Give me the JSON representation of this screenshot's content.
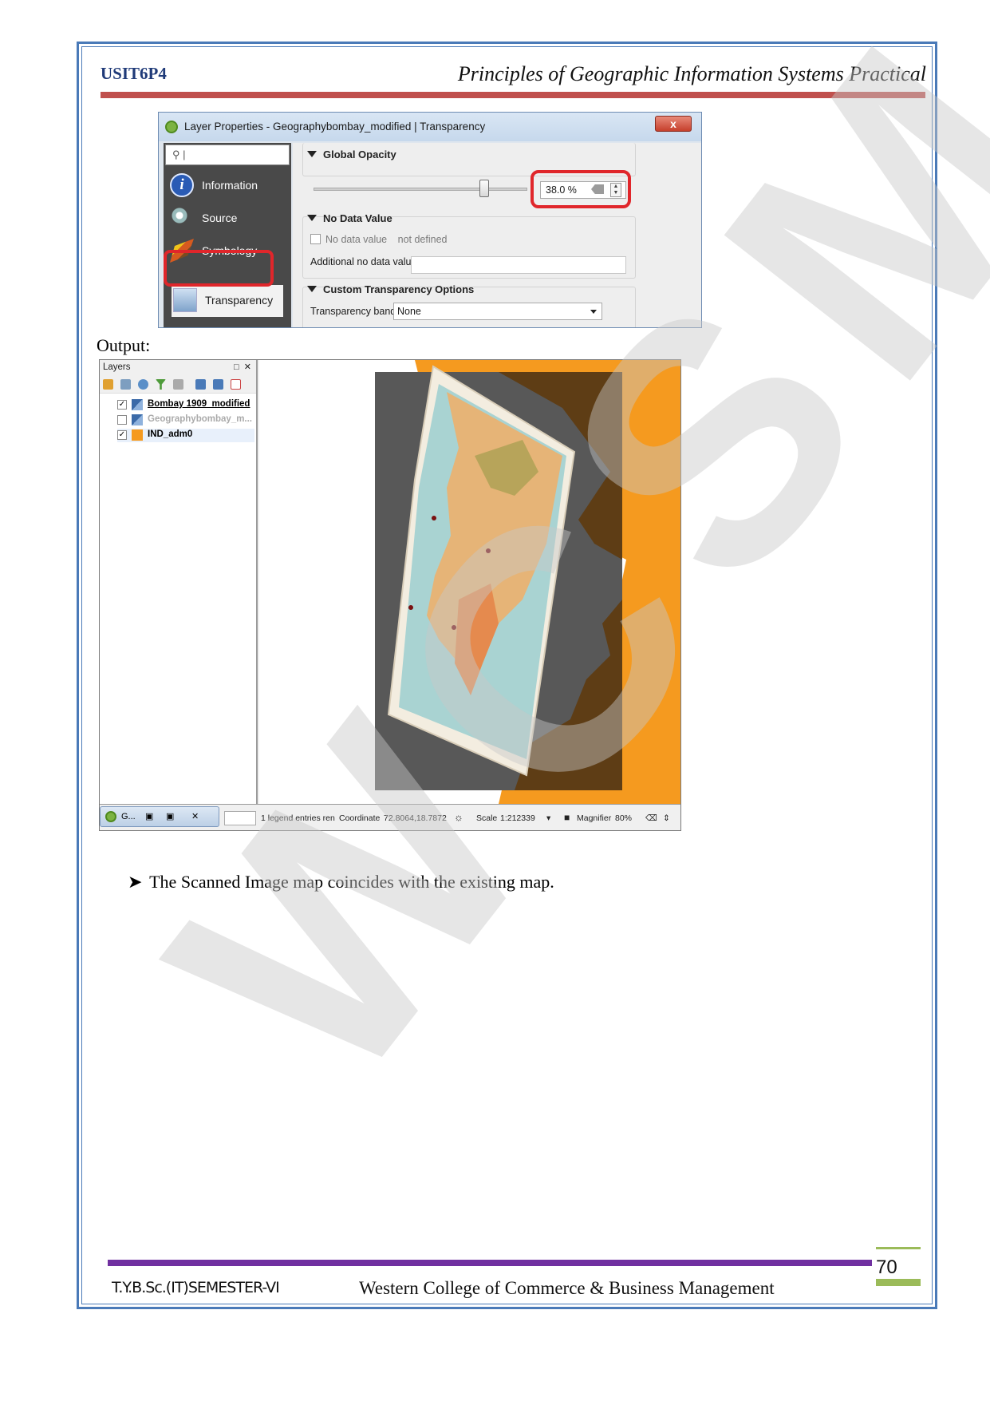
{
  "header": {
    "course_code": "USIT6P4",
    "title": "Principles of Geographic Information Systems Practical"
  },
  "dialog": {
    "title": "Layer Properties - Geographybombay_modified | Transparency",
    "close_label": "x",
    "search_value": "|",
    "sidebar_items": [
      {
        "label": "Information",
        "icon": "information-icon"
      },
      {
        "label": "Source",
        "icon": "source-icon"
      },
      {
        "label": "Symbology",
        "icon": "symbology-icon"
      },
      {
        "label": "Transparency",
        "icon": "transparency-icon",
        "selected": true
      }
    ],
    "global_opacity": {
      "header": "Global Opacity",
      "value_text": "38.0 %",
      "value": 38.0
    },
    "no_data": {
      "header": "No Data Value",
      "checkbox_label": "No data value",
      "checkbox_value": "not defined",
      "additional_label": "Additional no data value",
      "additional_value": ""
    },
    "custom_transparency": {
      "header": "Custom Transparency Options",
      "band_label": "Transparency band",
      "band_value": "None"
    }
  },
  "output_label": "Output:",
  "qgis": {
    "layers_title": "Layers",
    "layers": [
      {
        "name": "Bombay 1909_modified",
        "checked": true,
        "swatch": "raster-icon"
      },
      {
        "name": "Geographybombay_m...",
        "checked": false,
        "swatch": "raster-icon"
      },
      {
        "name": "IND_adm0",
        "checked": true,
        "swatch": "#f59a1f"
      }
    ],
    "status": {
      "task_label": "G...",
      "legend_text": "1 legend entries ren",
      "coordinate_label": "Coordinate",
      "coordinate_value": "72.8064,18.7872",
      "scale_label": "Scale",
      "scale_value": "1:212339",
      "magnifier_label": "Magnifier",
      "magnifier_value": "80%"
    }
  },
  "bullet_text": "The Scanned Image map coincides with the existing map.",
  "footer": {
    "left": "T.Y.B.Sc.(IT)SEMESTER-VI",
    "center": "Western College of Commerce & Business Management",
    "page_number": "70"
  },
  "watermark": "WCSM",
  "colors": {
    "header_rule": "#c0504d",
    "footer_rule": "#7030a0",
    "page_accent": "#9bbb59",
    "frame": "#4a7ab8",
    "highlight": "#e0262b",
    "india_fill": "#f59a1f"
  }
}
